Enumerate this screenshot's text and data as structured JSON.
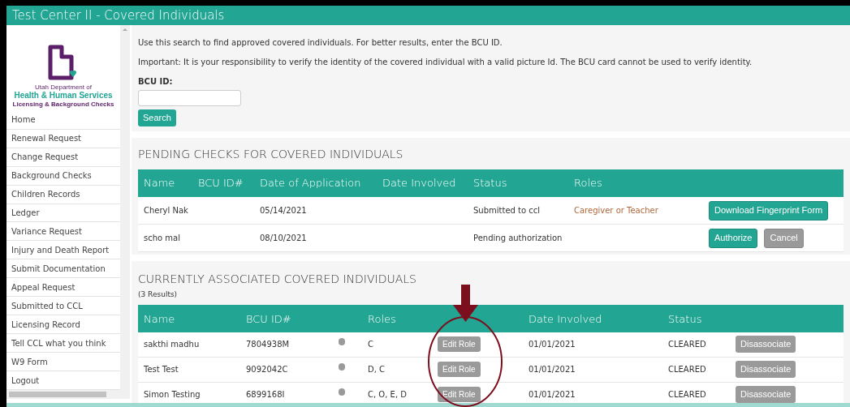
{
  "window": {
    "title": "Test Center II - Covered Individuals"
  },
  "logo": {
    "line_1": "Utah Department of",
    "line_2": "Health & Human Services",
    "line_3": "Licensing & Background Checks"
  },
  "sidebar": {
    "items": [
      {
        "label": "Home"
      },
      {
        "label": "Renewal Request"
      },
      {
        "label": "Change Request"
      },
      {
        "label": "Background Checks"
      },
      {
        "label": "Children Records"
      },
      {
        "label": "Ledger"
      },
      {
        "label": "Variance Request"
      },
      {
        "label": "Injury and Death Report"
      },
      {
        "label": "Submit Documentation"
      },
      {
        "label": "Appeal Request"
      },
      {
        "label": "Submitted to CCL"
      },
      {
        "label": "Licensing Record"
      },
      {
        "label": "Tell CCL what you think"
      },
      {
        "label": "W9 Form"
      },
      {
        "label": "Logout"
      }
    ]
  },
  "search": {
    "intro": "Use this search to find approved covered individuals. For better results, enter the BCU ID.",
    "notice": "Important: It is your responsibility to verify the identity of the covered individual with a valid picture Id. The BCU card cannot be used to verify identity.",
    "field_label": "BCU ID:",
    "button": "Search"
  },
  "pending": {
    "title": "PENDING CHECKS FOR COVERED INDIVIDUALS",
    "columns": [
      "Name",
      "BCU ID#",
      "Date of Application",
      "Date Involved",
      "Status",
      "Roles"
    ],
    "rows": [
      {
        "name": "Cheryl Nak",
        "date_of_application": "05/14/2021",
        "status": "Submitted to ccl",
        "roles": "Caregiver or Teacher",
        "actions": [
          {
            "label": "Download Fingerprint Form",
            "kind": "primary"
          }
        ]
      },
      {
        "name": "scho mal",
        "date_of_application": "08/10/2021",
        "status": "Pending authorization",
        "actions": [
          {
            "label": "Authorize",
            "kind": "primary"
          },
          {
            "label": "Cancel",
            "kind": "secondary"
          }
        ]
      }
    ]
  },
  "associated": {
    "title": "CURRENTLY ASSOCIATED COVERED INDIVIDUALS",
    "count": "(3 Results)",
    "columns": [
      "Name",
      "BCU ID#",
      "Roles",
      "Date Involved",
      "Status"
    ],
    "rows": [
      {
        "name": "sakthi madhu",
        "bcu_id": "7804938M",
        "roles": "C",
        "edit": "Edit Role",
        "date_involved": "01/01/2021",
        "status": "CLEARED",
        "action": "Disassociate"
      },
      {
        "name": "Test Test",
        "bcu_id": "9092042C",
        "roles": "D, C",
        "edit": "Edit Role",
        "date_involved": "01/01/2021",
        "status": "CLEARED",
        "action": "Disassociate"
      },
      {
        "name": "Simon Testing",
        "bcu_id": "6899168I",
        "roles": "C, O, E, D",
        "edit": "Edit Role",
        "date_involved": "01/01/2021",
        "status": "CLEARED",
        "action": "Disassociate"
      }
    ]
  }
}
